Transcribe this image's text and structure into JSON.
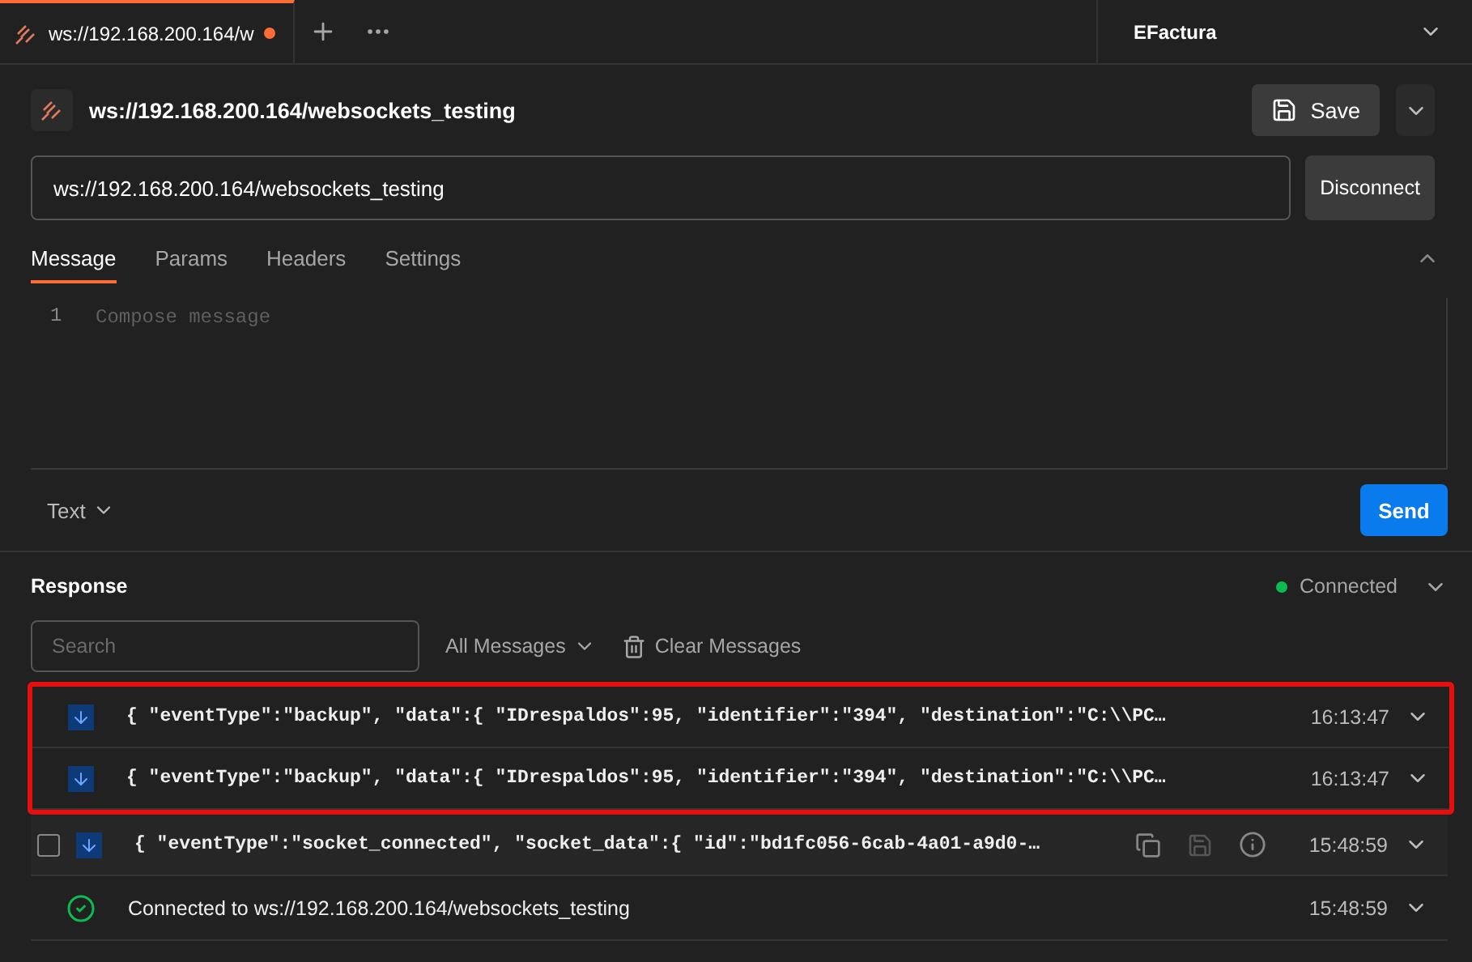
{
  "tabs": [
    {
      "label": "ws://192.168.200.164/w",
      "selected": true,
      "unsaved": true
    }
  ],
  "environment": "EFactura",
  "request": {
    "title": "ws://192.168.200.164/websockets_testing",
    "save": "Save",
    "url": "ws://192.168.200.164/websockets_testing",
    "connect_button": "Disconnect"
  },
  "message_tabs": [
    {
      "label": "Message",
      "selected": true
    },
    {
      "label": "Params",
      "selected": false
    },
    {
      "label": "Headers",
      "selected": false
    },
    {
      "label": "Settings",
      "selected": false
    }
  ],
  "editor": {
    "line_number": "1",
    "placeholder": "Compose message",
    "format": "Text",
    "send": "Send"
  },
  "response": {
    "title": "Response",
    "status": "Connected",
    "connected": true,
    "search_placeholder": "Search",
    "filter": "All Messages",
    "clear": "Clear Messages"
  },
  "messages": [
    {
      "kind": "incoming",
      "text": "{ \"eventType\":\"backup\", \"data\":{ \"IDrespaldos\":95, \"identifier\":\"394\", \"destination\":\"C:\\\\PC…",
      "time": "16:13:47",
      "hovered": false,
      "highlighted": true
    },
    {
      "kind": "incoming",
      "text": "{ \"eventType\":\"backup\", \"data\":{ \"IDrespaldos\":95, \"identifier\":\"394\", \"destination\":\"C:\\\\PC…",
      "time": "16:13:47",
      "hovered": false,
      "highlighted": true
    },
    {
      "kind": "incoming",
      "text": "{ \"eventType\":\"socket_connected\", \"socket_data\":{ \"id\":\"bd1fc056-6cab-4a01-a9d0-…",
      "time": "15:48:59",
      "hovered": true,
      "highlighted": false
    },
    {
      "kind": "status",
      "text": "Connected to ws://192.168.200.164/websockets_testing",
      "time": "15:48:59",
      "hovered": false,
      "highlighted": false
    }
  ]
}
